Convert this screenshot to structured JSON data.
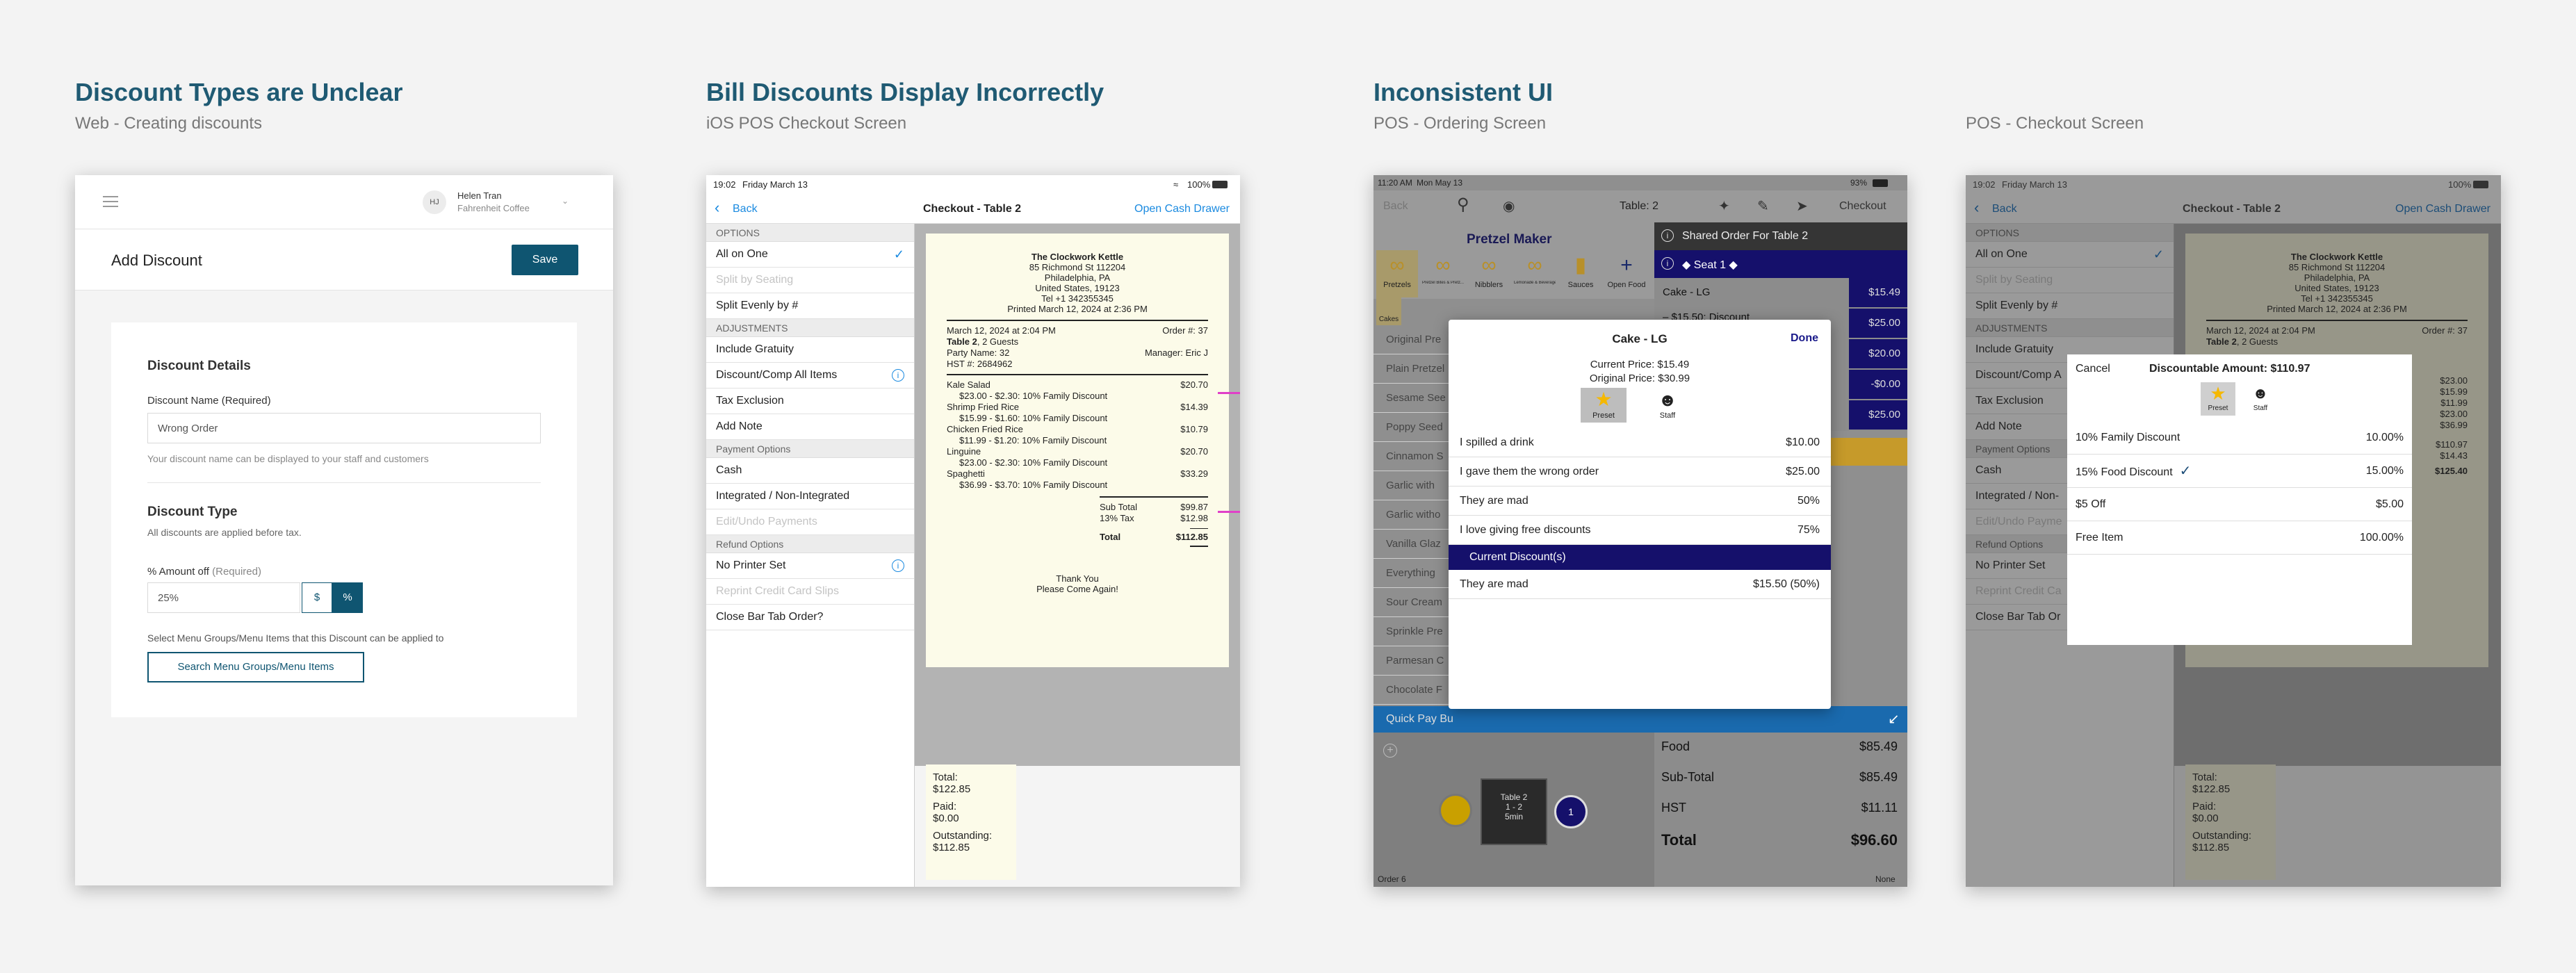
{
  "sections": [
    {
      "title": "Discount Types are Unclear",
      "subtitle": "Web - Creating discounts"
    },
    {
      "title": "Bill Discounts Display Incorrectly",
      "subtitle": "iOS POS Checkout Screen"
    },
    {
      "title": "Inconsistent UI",
      "subtitle": "POS - Ordering Screen"
    },
    {
      "title": "",
      "subtitle": "POS - Checkout Screen"
    }
  ],
  "web": {
    "user_initials": "HJ",
    "user_name": "Helen Tran",
    "user_org": "Fahrenheit Coffee",
    "page_title": "Add Discount",
    "save": "Save",
    "details_title": "Discount Details",
    "name_label": "Discount Name (Required)",
    "name_value": "Wrong Order",
    "name_help": "Your discount name can be displayed to your staff and customers",
    "type_title": "Discount Type",
    "type_help": "All discounts are applied before tax.",
    "amount_label": "% Amount off",
    "amount_req": "(Required)",
    "amount_value": "25%",
    "dollar": "$",
    "percent": "%",
    "apply_help": "Select Menu Groups/Menu Items that this Discount can be applied to",
    "search_btn": "Search Menu Groups/Menu Items"
  },
  "checkout": {
    "time": "19:02",
    "date": "Friday March 13",
    "battery": "100%",
    "back": "Back",
    "title": "Checkout - Table 2",
    "open_drawer": "Open Cash Drawer",
    "rows": [
      {
        "type": "sec",
        "label": "OPTIONS"
      },
      {
        "type": "row",
        "label": "All on One",
        "check": true
      },
      {
        "type": "row",
        "label": "Split by Seating",
        "disabled": true
      },
      {
        "type": "row",
        "label": "Split Evenly by #"
      },
      {
        "type": "sec",
        "label": "ADJUSTMENTS"
      },
      {
        "type": "row",
        "label": "Include Gratuity"
      },
      {
        "type": "row",
        "label": "Discount/Comp All Items",
        "info": true
      },
      {
        "type": "row",
        "label": "Tax Exclusion"
      },
      {
        "type": "row",
        "label": "Add Note"
      },
      {
        "type": "sec",
        "label": "Payment Options"
      },
      {
        "type": "row",
        "label": "Cash"
      },
      {
        "type": "row",
        "label": "Integrated / Non-Integrated"
      },
      {
        "type": "row",
        "label": "Edit/Undo Payments",
        "disabled": true
      },
      {
        "type": "sec",
        "label": "Refund Options"
      },
      {
        "type": "row",
        "label": "No Printer Set",
        "info": true
      },
      {
        "type": "row",
        "label": "Reprint Credit Card Slips",
        "disabled": true
      },
      {
        "type": "row",
        "label": "Close Bar Tab Order?"
      }
    ],
    "receipt": {
      "name": "The Clockwork Kettle",
      "addr1": "85 Richmond St 112204",
      "addr2": "Philadelphia, PA",
      "addr3": "United States, 19123",
      "tel": "Tel +1 342355345",
      "printed": "Printed March 12, 2024 at 2:36 PM",
      "date": "March 12, 2024 at 2:04 PM",
      "order": "Order #: 37",
      "table": "Table 2",
      "guests": ", 2 Guests",
      "party": "Party Name: 32",
      "manager": "Manager: Eric J",
      "hst": "HST #: 2684962",
      "items": [
        {
          "name": "Kale Salad",
          "price": "$20.70",
          "detail": "$23.00 - $2.30: 10% Family Discount"
        },
        {
          "name": "Shrimp Fried Rice",
          "price": "$14.39",
          "detail": "$15.99 - $1.60: 10% Family Discount"
        },
        {
          "name": "Chicken Fried Rice",
          "price": "$10.79",
          "detail": "$11.99 - $1.20: 10% Family Discount"
        },
        {
          "name": "Linguine",
          "price": "$20.70",
          "detail": "$23.00 - $2.30: 10% Family Discount"
        },
        {
          "name": "Spaghetti",
          "price": "$33.29",
          "detail": "$36.99 - $3.70: 10% Family Discount"
        }
      ],
      "subtotal_label": "Sub Total",
      "subtotal": "$99.87",
      "tax_label": "13% Tax",
      "tax": "$12.98",
      "total_label": "Total",
      "total": "$112.85",
      "thanks": "Thank You",
      "again": "Please Come Again!"
    },
    "summary": {
      "total_label": "Total:",
      "total": "$122.85",
      "paid_label": "Paid:",
      "paid": "$0.00",
      "outstanding_label": "Outstanding:",
      "outstanding": "$112.85"
    }
  },
  "ordering": {
    "time": "11:20 AM",
    "date": "Mon May 13",
    "battery": "93%",
    "back": "Back",
    "table": "Table: 2",
    "checkout": "Checkout",
    "brand": "Pretzel Maker",
    "categories": [
      "Pretzels",
      "Pretzel Bites & Pretz...",
      "Nibblers",
      "Lemonade & Beverages",
      "Sauces",
      "Open Food"
    ],
    "cakes": "Cakes",
    "shared_order": "Shared Order For Table 2",
    "seat": "◆  Seat 1  ◆",
    "menu_items": [
      "Original Pre",
      "Plain Pretzel",
      "Sesame See",
      "Poppy Seed",
      "Cinnamon S",
      "Garlic with",
      "Garlic witho",
      "Vanilla Glaz",
      "Everything",
      "Sour Cream",
      "Sprinkle Pre",
      "Parmesan C",
      "Chocolate F"
    ],
    "order_lines": [
      {
        "name": "Cake - LG",
        "price": "$15.49"
      },
      {
        "name": "– $15.50: Discount",
        "price": "$25.00"
      },
      {
        "name": "",
        "price": "$20.00"
      },
      {
        "name": "",
        "price": "-$0.00"
      },
      {
        "name": "",
        "price": "$25.00"
      }
    ],
    "quick_pay": "Quick Pay Bu",
    "table_badge": "Table 2",
    "table_seats": "1 - 2",
    "table_time": "5min",
    "order_footer": "Order 6",
    "none_footer": "None",
    "food_label": "Food",
    "food": "$85.49",
    "subtotal_label": "Sub-Total",
    "subtotal": "$85.49",
    "hst_label": "HST",
    "hst": "$11.11",
    "total_label": "Total",
    "total": "$96.60",
    "modal": {
      "title": "Cake - LG",
      "done": "Done",
      "current": "Current Price: $15.49",
      "original": "Original Price: $30.99",
      "preset": "Preset",
      "staff": "Staff",
      "options": [
        {
          "label": "I spilled a drink",
          "value": "$10.00"
        },
        {
          "label": "I gave them the wrong order",
          "value": "$25.00"
        },
        {
          "label": "They are mad",
          "value": "50%"
        },
        {
          "label": "I love giving free discounts",
          "value": "75%"
        }
      ],
      "current_header": "Current Discount(s)",
      "current_item": {
        "label": "They are mad",
        "value": "$15.50 (50%)"
      }
    }
  },
  "pos_checkout": {
    "time": "19:02",
    "date": "Friday March 13",
    "battery": "100%",
    "back": "Back",
    "title": "Checkout - Table 2",
    "open_drawer": "Open Cash Drawer",
    "modal": {
      "cancel": "Cancel",
      "title": "Discountable Amount: $110.97",
      "preset": "Preset",
      "staff": "Staff",
      "options": [
        {
          "label": "10% Family Discount",
          "value": "10.00%",
          "check": false
        },
        {
          "label": "15% Food Discount",
          "value": "15.00%",
          "check": true
        },
        {
          "label": "$5 Off",
          "value": "$5.00",
          "check": false
        },
        {
          "label": "Free Item",
          "value": "100.00%",
          "check": false
        }
      ]
    },
    "left_rows": [
      {
        "type": "sec",
        "label": "OPTIONS"
      },
      {
        "type": "row",
        "label": "All on One",
        "check": true
      },
      {
        "type": "row",
        "label": "Split by Seating",
        "disabled": true
      },
      {
        "type": "row",
        "label": "Split Evenly by #"
      },
      {
        "type": "sec",
        "label": "ADJUSTMENTS"
      },
      {
        "type": "row",
        "label": "Include Gratuity"
      },
      {
        "type": "row",
        "label": "Discount/Comp A"
      },
      {
        "type": "row",
        "label": "Tax Exclusion"
      },
      {
        "type": "row",
        "label": "Add Note"
      },
      {
        "type": "sec",
        "label": "Payment Options"
      },
      {
        "type": "row",
        "label": "Cash"
      },
      {
        "type": "row",
        "label": "Integrated / Non-"
      },
      {
        "type": "row",
        "label": "Edit/Undo Payme",
        "disabled": true
      },
      {
        "type": "sec",
        "label": "Refund Options"
      },
      {
        "type": "row",
        "label": "No Printer Set"
      },
      {
        "type": "row",
        "label": "Reprint Credit Ca",
        "disabled": true
      },
      {
        "type": "row",
        "label": "Close Bar Tab Or"
      }
    ],
    "receipt": {
      "name": "The Clockwork Kettle",
      "addr1": "85 Richmond St 112204",
      "addr2": "Philadelphia, PA",
      "addr3": "United States, 19123",
      "tel": "Tel +1 342355345",
      "printed": "Printed March 12, 2024 at 2:36 PM",
      "date": "March 12, 2024 at 2:04 PM",
      "order": "Order #: 37",
      "table": "Table 2",
      "guests": ", 2 Guests",
      "prices": [
        "$23.00",
        "$15.99",
        "$11.99",
        "$23.00",
        "$36.99"
      ],
      "subtotal": "$110.97",
      "tax": "$14.43",
      "total": "$125.40"
    },
    "summary": {
      "total_label": "Total:",
      "total": "$122.85",
      "paid_label": "Paid:",
      "paid": "$0.00",
      "outstanding_label": "Outstanding:",
      "outstanding": "$112.85"
    }
  },
  "colors": {
    "heading": "#1f5a73",
    "primary": "#0f5571",
    "navy": "#15106b",
    "accent_pink": "#e040c8",
    "orange": "#e8a200",
    "blue": "#1a8ae0"
  }
}
